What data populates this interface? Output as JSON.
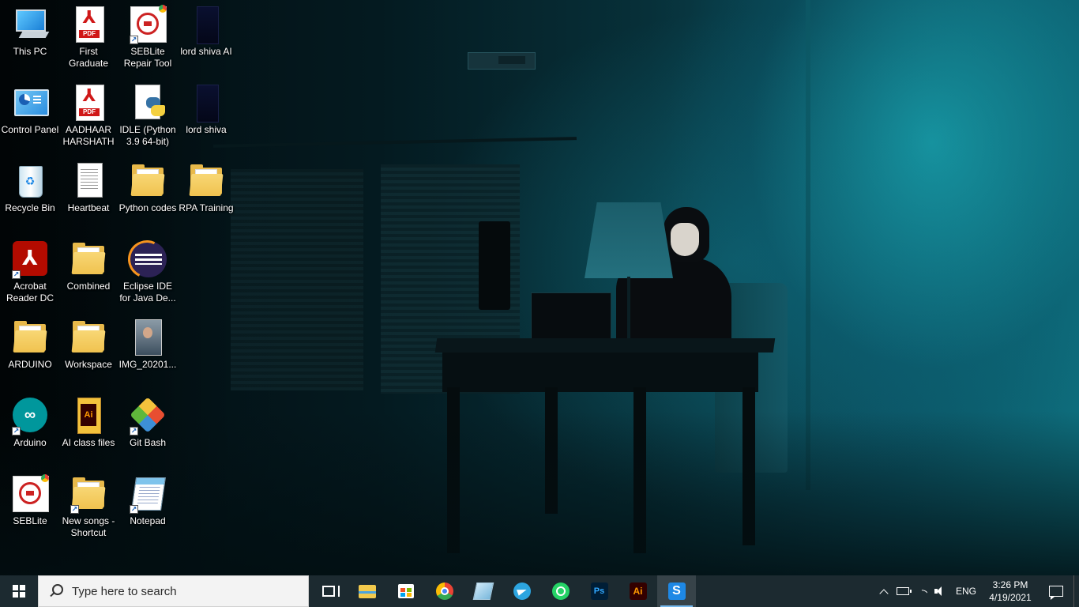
{
  "desktop": {
    "icons": [
      {
        "label": "This PC",
        "icon": "pc-icon"
      },
      {
        "label": "First Graduate",
        "icon": "pdf-icon"
      },
      {
        "label": "SEBLite Repair Tool",
        "icon": "seblite-icon"
      },
      {
        "label": "lord shiva AI",
        "icon": "image-icon"
      },
      {
        "label": "Control Panel",
        "icon": "control-panel-icon"
      },
      {
        "label": "AADHAAR HARSHATH",
        "icon": "pdf-icon"
      },
      {
        "label": "IDLE (Python 3.9 64-bit)",
        "icon": "python-icon"
      },
      {
        "label": "lord shiva",
        "icon": "image-icon"
      },
      {
        "label": "Recycle Bin",
        "icon": "recycle-bin-icon"
      },
      {
        "label": "Heartbeat",
        "icon": "text-file-icon"
      },
      {
        "label": "Python codes",
        "icon": "folder-icon"
      },
      {
        "label": "RPA Training",
        "icon": "folder-icon"
      },
      {
        "label": "Acrobat Reader DC",
        "icon": "acrobat-icon"
      },
      {
        "label": "Combined",
        "icon": "folder-icon"
      },
      {
        "label": "Eclipse IDE for Java De...",
        "icon": "eclipse-icon"
      },
      {
        "label": "ARDUINO",
        "icon": "folder-icon"
      },
      {
        "label": "Workspace",
        "icon": "folder-icon"
      },
      {
        "label": "IMG_20201...",
        "icon": "photo-icon"
      },
      {
        "label": "Arduino",
        "icon": "arduino-icon"
      },
      {
        "label": "AI class files",
        "icon": "book-icon"
      },
      {
        "label": "Git Bash",
        "icon": "git-icon"
      },
      {
        "label": "SEBLite",
        "icon": "seblite-icon"
      },
      {
        "label": "New songs - Shortcut",
        "icon": "folder-icon"
      },
      {
        "label": "Notepad",
        "icon": "notepad-icon"
      }
    ]
  },
  "taskbar": {
    "search_placeholder": "Type here to search",
    "pinned": [
      {
        "name": "Task View",
        "icon": "task-view-icon"
      },
      {
        "name": "File Explorer",
        "icon": "file-explorer-icon"
      },
      {
        "name": "Microsoft Store",
        "icon": "store-icon"
      },
      {
        "name": "Google Chrome",
        "icon": "chrome-icon"
      },
      {
        "name": "App",
        "icon": "cube-icon"
      },
      {
        "name": "Telegram",
        "icon": "telegram-icon"
      },
      {
        "name": "WhatsApp",
        "icon": "whatsapp-icon"
      },
      {
        "name": "Photoshop",
        "icon": "photoshop-icon",
        "text": "Ps"
      },
      {
        "name": "Illustrator",
        "icon": "illustrator-icon",
        "text": "Ai"
      },
      {
        "name": "SEBLite",
        "icon": "seblite-icon",
        "active": true
      }
    ],
    "tray": {
      "language": "ENG",
      "time": "3:26 PM",
      "date": "4/19/2021"
    },
    "accent": "#76b9ed"
  }
}
